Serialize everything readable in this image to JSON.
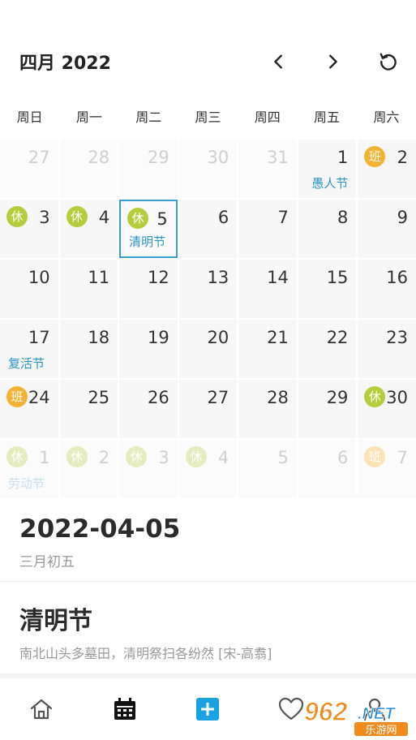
{
  "header": {
    "month_title": "四月 2022"
  },
  "weekdays": [
    "周日",
    "周一",
    "周二",
    "周三",
    "周四",
    "周五",
    "周六"
  ],
  "calendar": {
    "rows": [
      [
        {
          "day": "27",
          "other": true
        },
        {
          "day": "28",
          "other": true
        },
        {
          "day": "29",
          "other": true
        },
        {
          "day": "30",
          "other": true
        },
        {
          "day": "31",
          "other": true
        },
        {
          "day": "1",
          "festival": "愚人节",
          "festival_align": "right"
        },
        {
          "day": "2",
          "badge": "班",
          "badge_type": "work"
        }
      ],
      [
        {
          "day": "3",
          "badge": "休",
          "badge_type": "rest"
        },
        {
          "day": "4",
          "badge": "休",
          "badge_type": "rest"
        },
        {
          "day": "5",
          "badge": "休",
          "badge_type": "rest",
          "festival": "清明节",
          "selected": true
        },
        {
          "day": "6"
        },
        {
          "day": "7"
        },
        {
          "day": "8"
        },
        {
          "day": "9"
        }
      ],
      [
        {
          "day": "10"
        },
        {
          "day": "11"
        },
        {
          "day": "12"
        },
        {
          "day": "13"
        },
        {
          "day": "14"
        },
        {
          "day": "15"
        },
        {
          "day": "16"
        }
      ],
      [
        {
          "day": "17",
          "festival": "复活节"
        },
        {
          "day": "18"
        },
        {
          "day": "19"
        },
        {
          "day": "20"
        },
        {
          "day": "21"
        },
        {
          "day": "22"
        },
        {
          "day": "23"
        }
      ],
      [
        {
          "day": "24",
          "badge": "班",
          "badge_type": "work"
        },
        {
          "day": "25"
        },
        {
          "day": "26"
        },
        {
          "day": "27"
        },
        {
          "day": "28"
        },
        {
          "day": "29"
        },
        {
          "day": "30",
          "badge": "休",
          "badge_type": "rest"
        }
      ],
      [
        {
          "day": "1",
          "other": true,
          "badge": "休",
          "badge_type": "rest",
          "festival": "劳动节"
        },
        {
          "day": "2",
          "other": true,
          "badge": "休",
          "badge_type": "rest"
        },
        {
          "day": "3",
          "other": true,
          "badge": "休",
          "badge_type": "rest"
        },
        {
          "day": "4",
          "other": true,
          "badge": "休",
          "badge_type": "rest"
        },
        {
          "day": "5",
          "other": true
        },
        {
          "day": "6",
          "other": true
        },
        {
          "day": "7",
          "other": true,
          "badge": "班",
          "badge_type": "work"
        }
      ]
    ]
  },
  "selected": {
    "date": "2022-04-05",
    "lunar": "三月初五",
    "festival_name": "清明节",
    "poem": "南北山头多墓田，清明祭扫各纷然 [宋-高翥]"
  },
  "watermark": {
    "main": "962",
    "suffix": ".NET",
    "sub": "乐游网"
  },
  "colors": {
    "accent": "#2d95c6",
    "rest_badge": "#b5cd3c",
    "work_badge": "#f2b233",
    "selected_border": "#3aa0d3"
  }
}
